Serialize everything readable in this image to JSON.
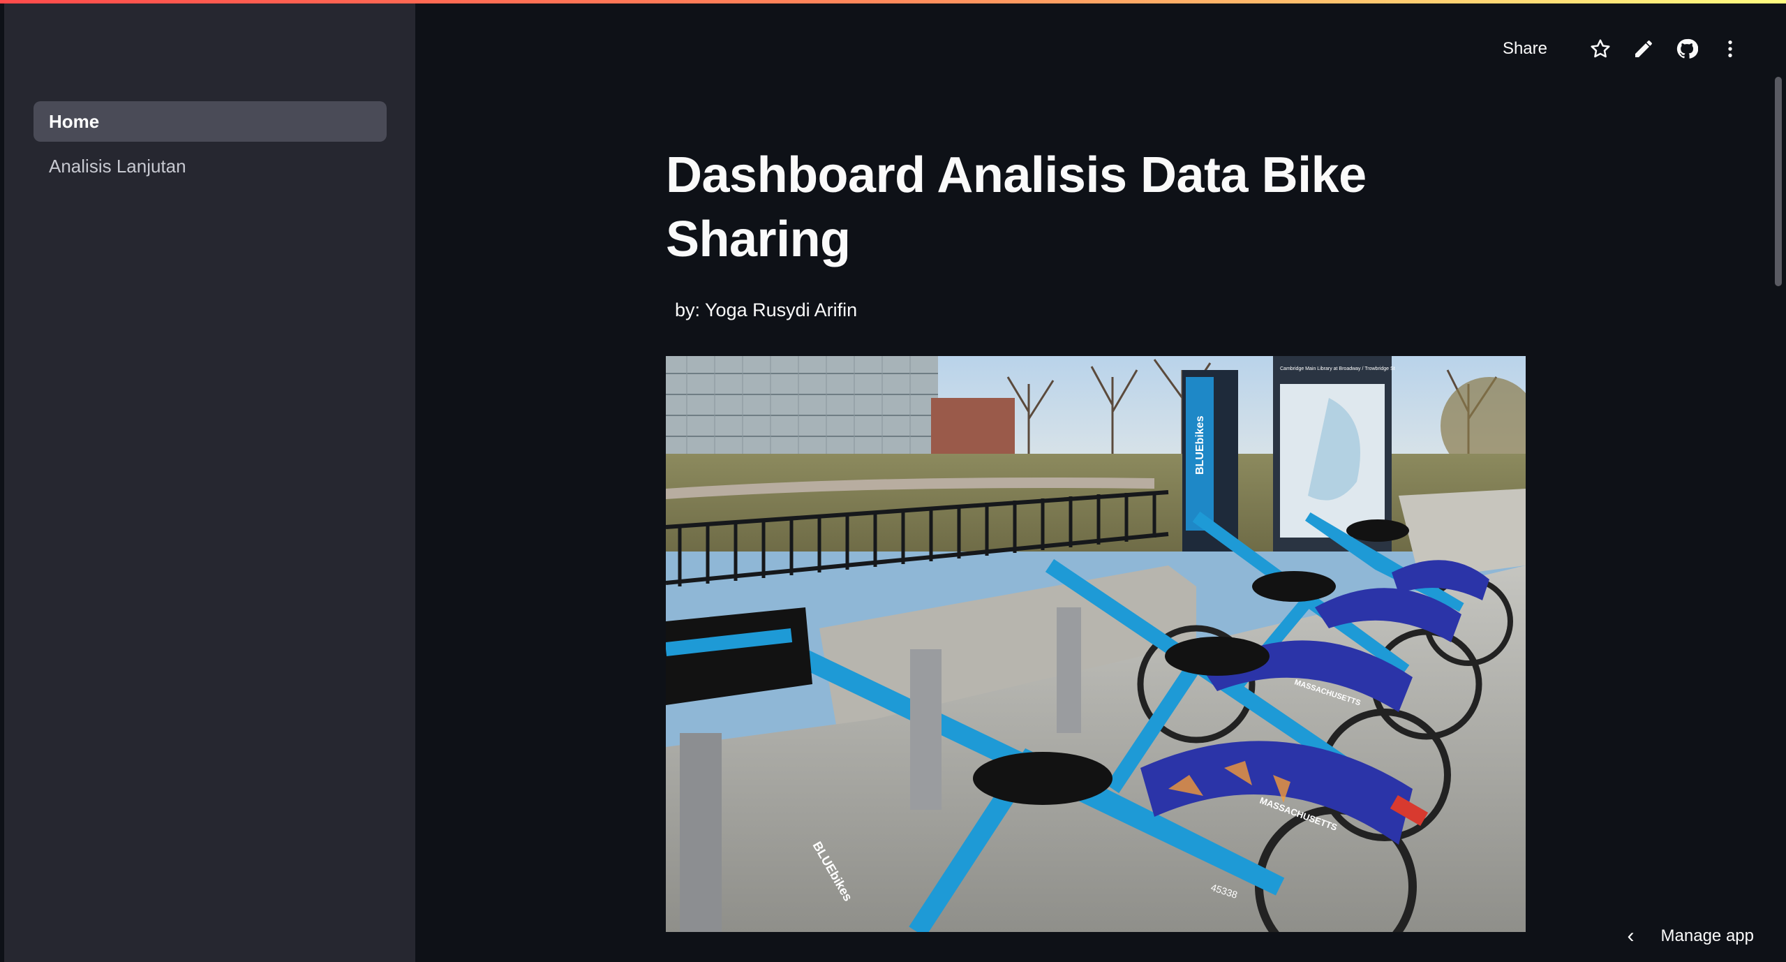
{
  "sidebar": {
    "items": [
      {
        "label": "Home",
        "active": true
      },
      {
        "label": "Analisis Lanjutan",
        "active": false
      }
    ]
  },
  "header": {
    "share_label": "Share",
    "icons": [
      "star-icon",
      "pencil-icon",
      "github-icon",
      "more-vertical-icon"
    ]
  },
  "main": {
    "title": "Dashboard Analisis Data Bike Sharing",
    "byline": "by: Yoga Rusydi Arifin",
    "hero_image": {
      "text_on_bike_side": "BLUEbikes",
      "text_on_fender": "MASSACHUSETTS",
      "text_on_bike_number": "45338",
      "text_on_station_sign": "BLUEbikes",
      "text_on_map_board": "Cambridge Main Library at Broadway / Trowbridge St"
    }
  },
  "footer": {
    "manage_app_label": "Manage app"
  },
  "colors": {
    "background": "#0e1117",
    "sidebar": "#262730",
    "active_nav": "#4a4b57",
    "bike_blue": "#1e9ad6",
    "fender_blue": "#2b34a8"
  }
}
